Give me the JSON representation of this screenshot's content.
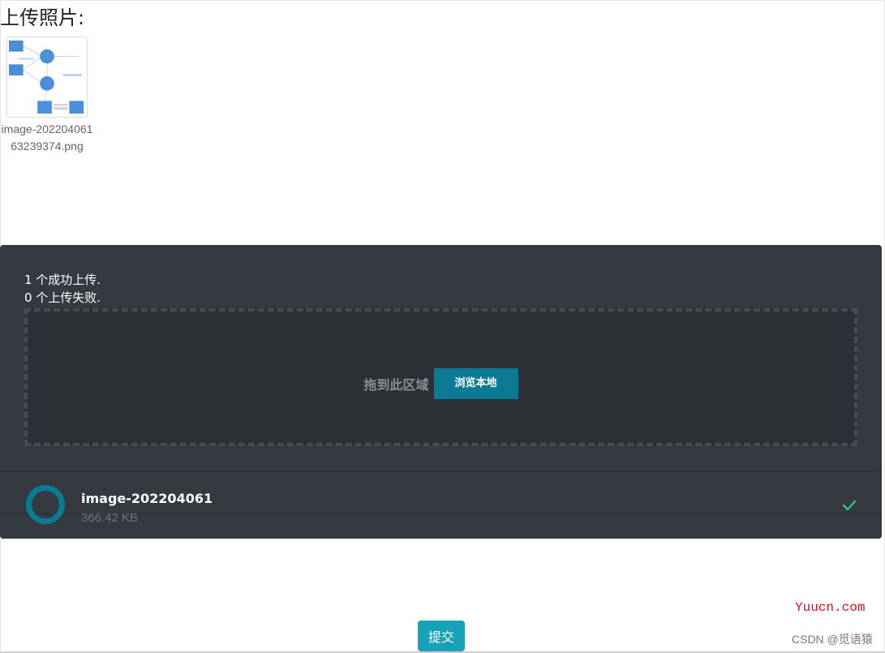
{
  "page": {
    "upload_title": "上传照片:"
  },
  "thumbnail": {
    "caption": "image-20220406163239374.png"
  },
  "uploader": {
    "success_status": "1 个成功上传.",
    "fail_status": "0 个上传失败.",
    "drop_text": "拖到此区域",
    "browse_label": "浏览本地",
    "accent_color": "#0b7a94",
    "files": [
      {
        "name": "image-202204061",
        "size": "366.42 KB",
        "status_icon": "check-icon"
      }
    ]
  },
  "form": {
    "submit_label": "提交",
    "submit_color": "#17a2b8"
  },
  "watermarks": {
    "site": "Yuucn.com",
    "csdn": "CSDN @觅语猿"
  }
}
